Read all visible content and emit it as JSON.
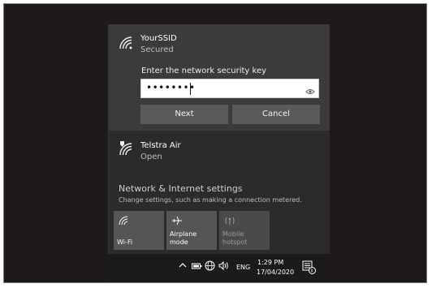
{
  "networks": {
    "selected": {
      "ssid": "YourSSID",
      "status": "Secured",
      "prompt": "Enter the network security key",
      "password_masked": "••••••••",
      "next_label": "Next",
      "cancel_label": "Cancel"
    },
    "other": {
      "ssid": "Telstra Air",
      "status": "Open"
    }
  },
  "settings": {
    "title": "Network & Internet settings",
    "description": "Change settings, such as making a connection metered."
  },
  "quick_actions": [
    {
      "label": "Wi-Fi",
      "icon": "wifi-icon"
    },
    {
      "label": "Airplane mode",
      "icon": "airplane-icon"
    },
    {
      "label_line1": "Mobile",
      "label_line2": "hotspot",
      "icon": "hotspot-icon"
    }
  ],
  "taskbar": {
    "language": "ENG",
    "time": "1:29 PM",
    "date": "17/04/2020"
  },
  "colors": {
    "flyout_bg": "#2b2b2b",
    "expanded_bg": "#3b3b3b",
    "button_bg": "#5a5a5a",
    "tile_bg": "#555555"
  }
}
